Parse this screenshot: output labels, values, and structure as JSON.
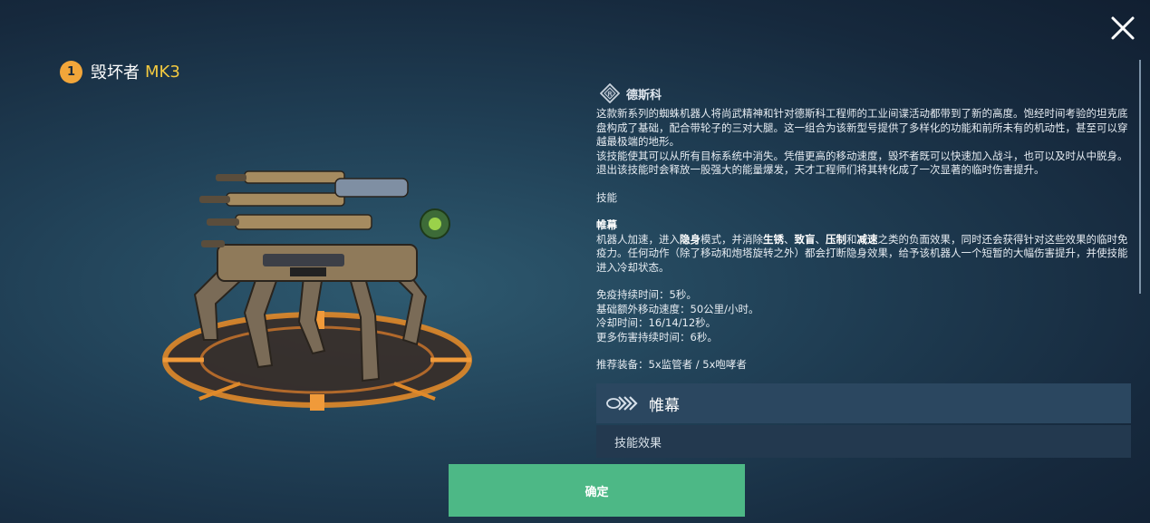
{
  "header": {
    "rank": "1",
    "name": "毁坏者",
    "grade": "MK3"
  },
  "icons": {
    "close": "close-icon",
    "faction": "dexxc-faction-icon",
    "ability": "ability-chevrons-icon"
  },
  "colors": {
    "rank_badge": "#f2a63a",
    "grade": "#f3c93f",
    "confirm": "#4db886",
    "accent_orange": "#e08a2a"
  },
  "info": {
    "faction": "德斯科",
    "description_1": "这款新系列的蜘蛛机器人将尚武精神和针对德斯科工程师的工业间谍活动都带到了新的高度。饱经时间考验的坦克底盘构成了基础，配合带轮子的三对大腿。这一组合为该新型号提供了多样化的功能和前所未有的机动性，甚至可以穿越最极端的地形。",
    "description_2": "该技能使其可以从所有目标系统中消失。凭借更高的移动速度，毁坏者既可以快速加入战斗，也可以及时从中脱身。退出该技能时会释放一股强大的能量爆发，天才工程师们将其转化成了一次显著的临时伤害提升。",
    "skills_heading": "技能",
    "skill_name": "帷幕",
    "skill_text": {
      "t1": "机器人加速，进入",
      "b1": "隐身",
      "t2": "模式，并消除",
      "b2": "生锈",
      "t3": "、",
      "b3": "致盲",
      "t4": "、",
      "b4": "压制",
      "t5": "和",
      "b5": "减速",
      "t6": "之类的负面效果，同时还会获得针对这些效果的临时免疫力。任何动作（除了移动和炮塔旋转之外）都会打断隐身效果，给予该机器人一个短暂的大幅伤害提升，并使技能进入冷却状态。"
    },
    "stats": [
      "免疫持续时间：5秒。",
      "基础额外移动速度：50公里/小时。",
      "冷却时间：16/14/12秒。",
      "更多伤害持续时间：6秒。"
    ],
    "recommended": "推荐装备：5x监管者 / 5x咆哮者"
  },
  "ability_card": {
    "title": "帷幕",
    "effect_label": "技能效果"
  },
  "confirm_label": "确定"
}
